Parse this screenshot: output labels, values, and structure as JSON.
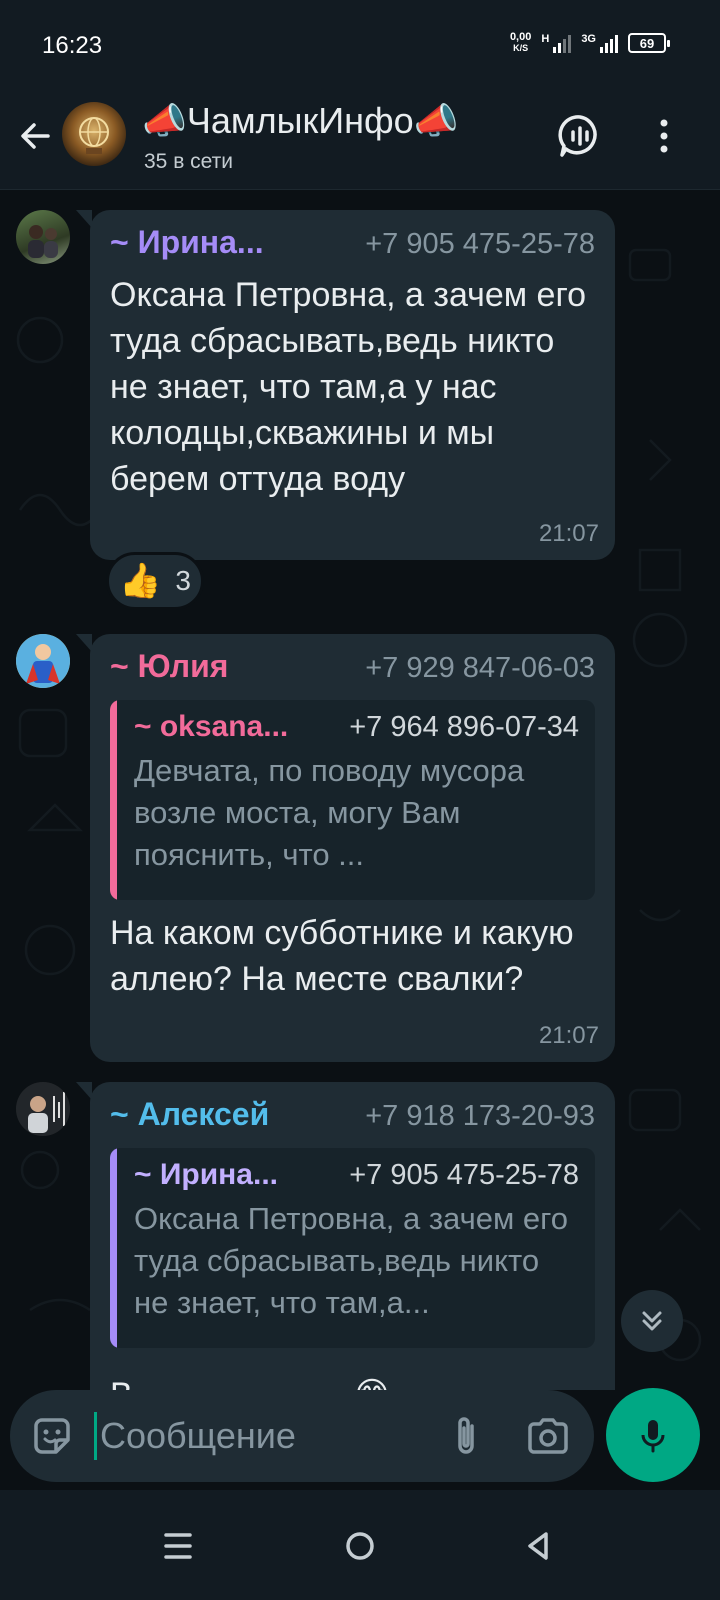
{
  "status_bar": {
    "time": "16:23",
    "net_speed_value": "0,00",
    "net_speed_unit": "K/S",
    "signal1_label": "H",
    "signal2_label": "3G",
    "battery": "69"
  },
  "header": {
    "title": "📣ЧамлыкИнфо📣",
    "subtitle": "35 в сети"
  },
  "messages": [
    {
      "sender": "~ Ирина...",
      "sender_color": "#a58cf7",
      "phone": "+7 905 475-25-78",
      "text": "Оксана Петровна, а зачем его туда сбрасывать,ведь никто не знает, что там,а у нас колодцы,скважины и мы берем оттуда воду",
      "time": "21:07",
      "reaction": {
        "emoji": "👍",
        "count": "3"
      }
    },
    {
      "sender": "~ Юлия",
      "sender_color": "#f26b9a",
      "phone": "+7 929 847-06-03",
      "quote": {
        "sender": "~ oksana...",
        "sender_color": "#f26b9a",
        "bar_color": "#f26b9a",
        "phone": "+7 964 896-07-34",
        "text": "Девчата, по поводу мусора возле моста, могу Вам пояснить, что ..."
      },
      "text": "На каком субботнике и какую аллею? На месте свалки?",
      "time": "21:07"
    },
    {
      "sender": "~ Алексей",
      "sender_color": "#53bdeb",
      "phone": "+7 918 173-20-93",
      "quote": {
        "sender": "~ Ирина...",
        "sender_color": "#c2b0ff",
        "bar_color": "#a58cf7",
        "phone": "+7 905 475-25-78",
        "text": "Оксана Петровна, а зачем его туда сбрасывать,ведь никто не знает, что там,а..."
      },
      "text": "В",
      "emoji": "😂"
    }
  ],
  "input": {
    "placeholder": "Сообщение"
  },
  "colors": {
    "accent": "#00a884",
    "bubble": "#1f2c34",
    "background": "#0b1014"
  },
  "icons": [
    "back-arrow-icon",
    "voice-chat-icon",
    "more-vert-icon",
    "sticker-icon",
    "attach-icon",
    "camera-icon",
    "mic-icon",
    "double-chevron-down-icon",
    "nav-menu-icon",
    "nav-home-icon",
    "nav-back-icon"
  ]
}
